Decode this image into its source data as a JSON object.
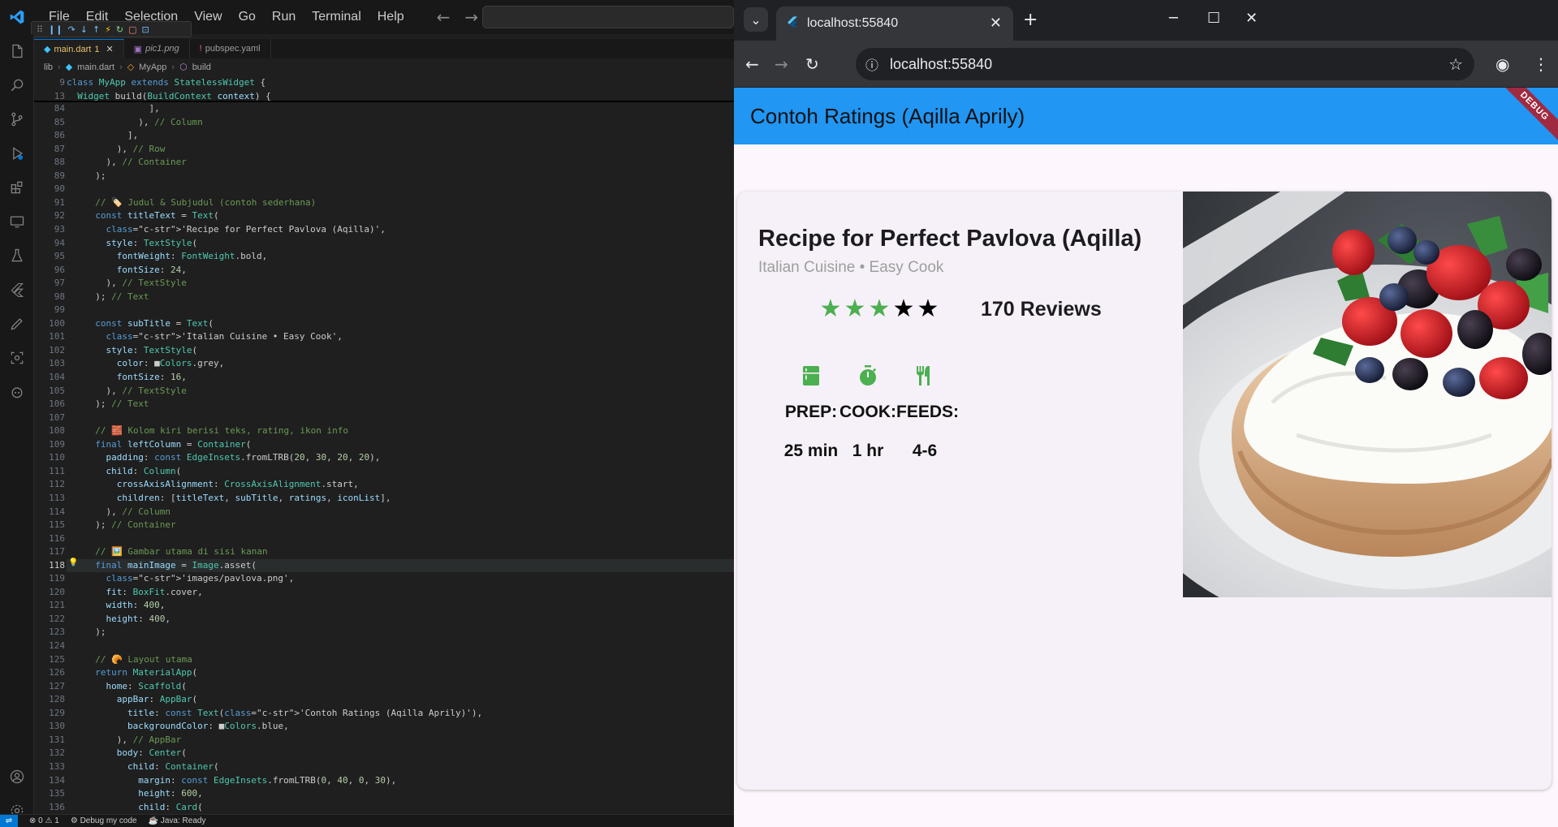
{
  "vscode": {
    "menu": [
      "File",
      "Edit",
      "Selection",
      "View",
      "Go",
      "Run",
      "Terminal",
      "Help"
    ],
    "tabs": [
      {
        "label": "main.dart",
        "badge": "1",
        "icon": "dart-file-icon"
      },
      {
        "label": "pic1.png",
        "icon": "image-file-icon"
      },
      {
        "label": "pubspec.yaml",
        "icon": "yaml-file-icon"
      }
    ],
    "breadcrumbs": [
      "lib",
      "main.dart",
      "MyApp",
      "build"
    ],
    "sticky": [
      {
        "n": "9",
        "t": "class MyApp extends StatelessWidget {"
      },
      {
        "n": "13",
        "t": "  Widget build(BuildContext context) {"
      }
    ],
    "lines": [
      {
        "n": "84",
        "t": "            ],"
      },
      {
        "n": "85",
        "t": "          ), // Column"
      },
      {
        "n": "86",
        "t": "        ],"
      },
      {
        "n": "87",
        "t": "      ), // Row"
      },
      {
        "n": "88",
        "t": "    ), // Container"
      },
      {
        "n": "89",
        "t": "  );"
      },
      {
        "n": "90",
        "t": ""
      },
      {
        "n": "91",
        "t": "  // 🏷️ Judul & Subjudul (contoh sederhana)"
      },
      {
        "n": "92",
        "t": "  const titleText = Text("
      },
      {
        "n": "93",
        "t": "    'Recipe for Perfect Pavlova (Aqilla)',"
      },
      {
        "n": "94",
        "t": "    style: TextStyle("
      },
      {
        "n": "95",
        "t": "      fontWeight: FontWeight.bold,"
      },
      {
        "n": "96",
        "t": "      fontSize: 24,"
      },
      {
        "n": "97",
        "t": "    ), // TextStyle"
      },
      {
        "n": "98",
        "t": "  ); // Text"
      },
      {
        "n": "99",
        "t": ""
      },
      {
        "n": "100",
        "t": "  const subTitle = Text("
      },
      {
        "n": "101",
        "t": "    'Italian Cuisine • Easy Cook',"
      },
      {
        "n": "102",
        "t": "    style: TextStyle("
      },
      {
        "n": "103",
        "t": "      color: ■Colors.grey,"
      },
      {
        "n": "104",
        "t": "      fontSize: 16,"
      },
      {
        "n": "105",
        "t": "    ), // TextStyle"
      },
      {
        "n": "106",
        "t": "  ); // Text"
      },
      {
        "n": "107",
        "t": ""
      },
      {
        "n": "108",
        "t": "  // 🧱 Kolom kiri berisi teks, rating, ikon info"
      },
      {
        "n": "109",
        "t": "  final leftColumn = Container("
      },
      {
        "n": "110",
        "t": "    padding: const EdgeInsets.fromLTRB(20, 30, 20, 20),"
      },
      {
        "n": "111",
        "t": "    child: Column("
      },
      {
        "n": "112",
        "t": "      crossAxisAlignment: CrossAxisAlignment.start,"
      },
      {
        "n": "113",
        "t": "      children: [titleText, subTitle, ratings, iconList],"
      },
      {
        "n": "114",
        "t": "    ), // Column"
      },
      {
        "n": "115",
        "t": "  ); // Container"
      },
      {
        "n": "116",
        "t": ""
      },
      {
        "n": "117",
        "t": "  // 🖼️ Gambar utama di sisi kanan"
      },
      {
        "n": "118",
        "t": "  final mainImage = Image.asset("
      },
      {
        "n": "119",
        "t": "    'images/pavlova.png',"
      },
      {
        "n": "120",
        "t": "    fit: BoxFit.cover,"
      },
      {
        "n": "121",
        "t": "    width: 400,"
      },
      {
        "n": "122",
        "t": "    height: 400,"
      },
      {
        "n": "123",
        "t": "  );"
      },
      {
        "n": "124",
        "t": ""
      },
      {
        "n": "125",
        "t": "  // 🥐 Layout utama"
      },
      {
        "n": "126",
        "t": "  return MaterialApp("
      },
      {
        "n": "127",
        "t": "    home: Scaffold("
      },
      {
        "n": "128",
        "t": "      appBar: AppBar("
      },
      {
        "n": "129",
        "t": "        title: const Text('Contoh Ratings (Aqilla Aprily)'),"
      },
      {
        "n": "130",
        "t": "        backgroundColor: ■Colors.blue,"
      },
      {
        "n": "131",
        "t": "      ), // AppBar"
      },
      {
        "n": "132",
        "t": "      body: Center("
      },
      {
        "n": "133",
        "t": "        child: Container("
      },
      {
        "n": "134",
        "t": "          margin: const EdgeInsets.fromLTRB(0, 40, 0, 30),"
      },
      {
        "n": "135",
        "t": "          height: 600,"
      },
      {
        "n": "136",
        "t": "          child: Card("
      }
    ],
    "current_line": "118",
    "status": {
      "errors": "0",
      "warnings": "1",
      "debug": "Debug my code",
      "java": "Java: Ready"
    }
  },
  "browser": {
    "tab_title": "localhost:55840",
    "url": "localhost:55840"
  },
  "app": {
    "appbar_title": "Contoh Ratings (Aqilla Aprily)",
    "debug_banner": "DEBUG",
    "title": "Recipe for Perfect Pavlova (Aqilla)",
    "subtitle": "Italian Cuisine • Easy Cook",
    "rating": {
      "filled": 3,
      "total": 5,
      "filled_color": "#4caf50",
      "empty_color": "#000000"
    },
    "reviews": "170 Reviews",
    "info": [
      {
        "icon": "kitchen-icon",
        "label": "PREP:",
        "value": "25 min"
      },
      {
        "icon": "timer-icon",
        "label": "COOK:",
        "value": "1 hr"
      },
      {
        "icon": "restaurant-icon",
        "label": "FEEDS:",
        "value": "4-6"
      }
    ],
    "accent_color": "#2196f3",
    "icon_color": "#4caf50"
  }
}
